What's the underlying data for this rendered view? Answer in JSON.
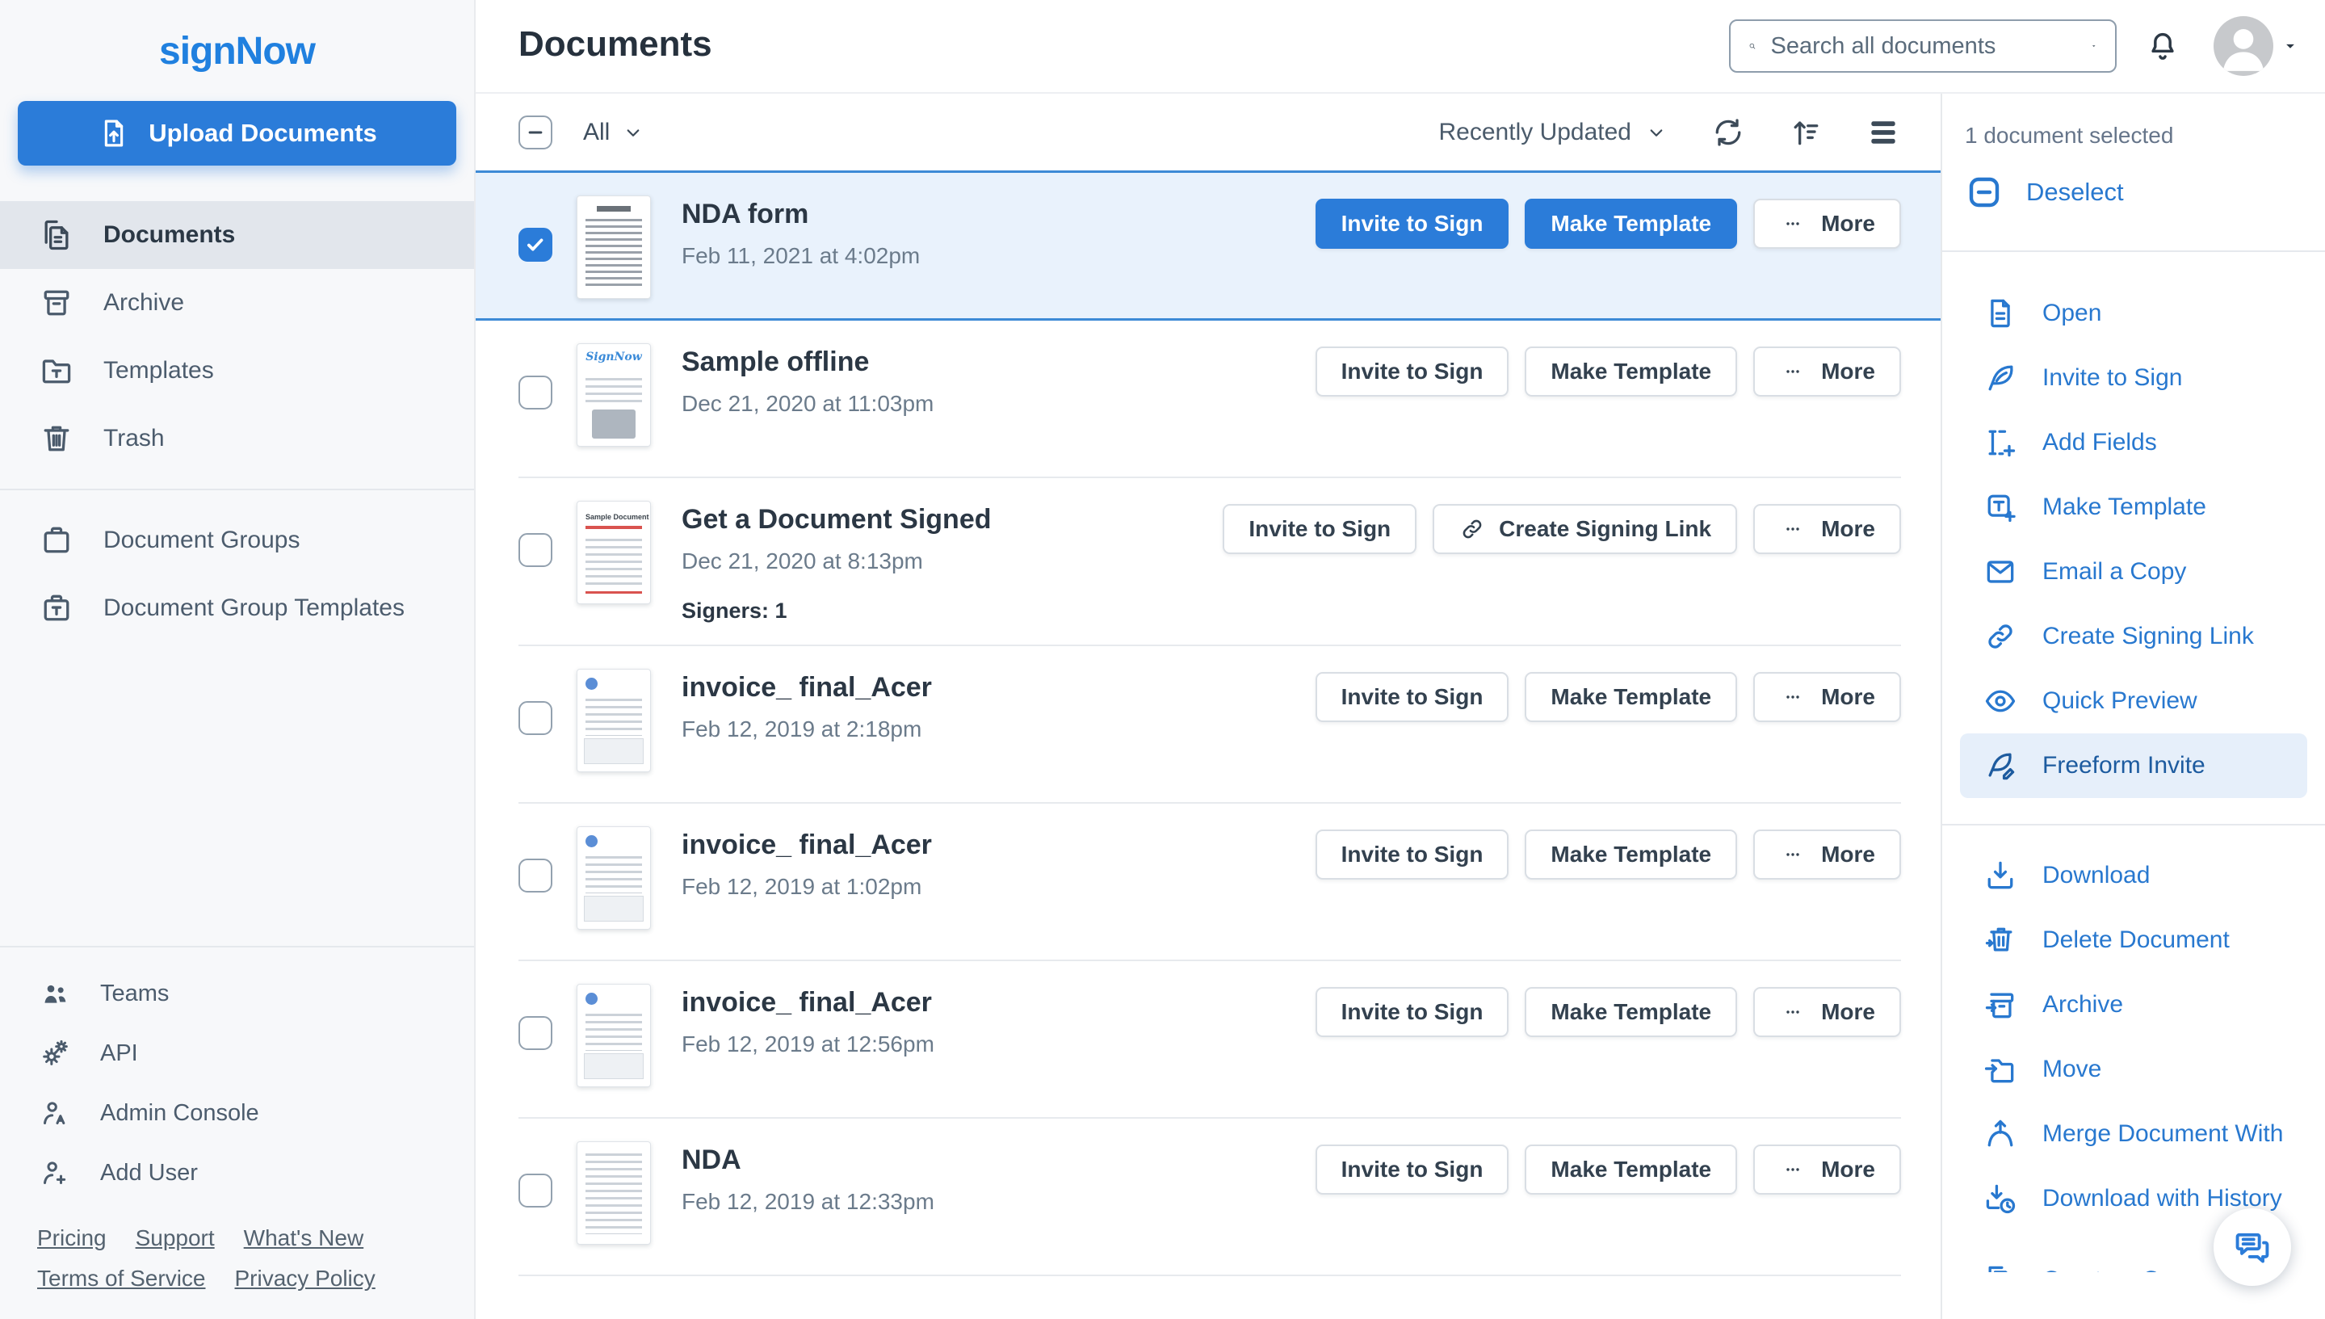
{
  "colors": {
    "primary_blue": "#2b7cd9",
    "logo_blue": "#2080df",
    "link_blue": "#2878cf",
    "active_item_blue": "#1d5b9f",
    "active_item_bg": "#e6effa",
    "selected_row_bg": "#e9f2fc",
    "selected_row_border": "#3d8ad6",
    "sidebar_bg": "#f7f8fa"
  },
  "sidebar": {
    "logo": "signNow",
    "upload_button": "Upload Documents",
    "nav": [
      {
        "key": "documents",
        "label": "Documents",
        "icon": "documents",
        "selected": true
      },
      {
        "key": "archive",
        "label": "Archive",
        "icon": "archive",
        "selected": false
      },
      {
        "key": "templates",
        "label": "Templates",
        "icon": "templates",
        "selected": false
      },
      {
        "key": "trash",
        "label": "Trash",
        "icon": "trash",
        "selected": false
      }
    ],
    "nav_secondary": [
      {
        "key": "document-groups",
        "label": "Document Groups",
        "icon": "doc-group"
      },
      {
        "key": "document-group-templates",
        "label": "Document Group Templates",
        "icon": "doc-group-template"
      }
    ],
    "nav_tertiary": [
      {
        "key": "teams",
        "label": "Teams",
        "icon": "teams"
      },
      {
        "key": "api",
        "label": "API",
        "icon": "api"
      },
      {
        "key": "admin-console",
        "label": "Admin Console",
        "icon": "admin"
      },
      {
        "key": "add-user",
        "label": "Add User",
        "icon": "add-user"
      }
    ],
    "footer_links": [
      "Pricing",
      "Support",
      "What's New",
      "Terms of Service",
      "Privacy Policy"
    ]
  },
  "header": {
    "title": "Documents",
    "search_placeholder": "Search all documents"
  },
  "toolbar": {
    "filter": "All",
    "sort": "Recently Updated"
  },
  "documents": [
    {
      "title": "NDA form",
      "date": "Feb 11, 2021 at 4:02pm",
      "selected": true,
      "thumb": "nda-form",
      "buttons": [
        {
          "label": "Invite to Sign",
          "style": "primary"
        },
        {
          "label": "Make Template",
          "style": "primary"
        },
        {
          "label": "More",
          "style": "more"
        }
      ]
    },
    {
      "title": "Sample offline",
      "date": "Dec 21, 2020 at 11:03pm",
      "selected": false,
      "thumb": "sample-offline",
      "buttons": [
        {
          "label": "Invite to Sign"
        },
        {
          "label": "Make Template"
        },
        {
          "label": "More",
          "style": "more"
        }
      ]
    },
    {
      "title": "Get a Document Signed",
      "date": "Dec 21, 2020 at 8:13pm",
      "signers": "Signers: 1",
      "selected": false,
      "thumb": "sample-doc",
      "buttons": [
        {
          "label": "Invite to Sign"
        },
        {
          "label": "Create Signing Link",
          "icon": "link"
        },
        {
          "label": "More",
          "style": "more"
        }
      ]
    },
    {
      "title": "invoice_ final_Acer",
      "date": "Feb 12, 2019 at 2:18pm",
      "selected": false,
      "thumb": "invoice",
      "buttons": [
        {
          "label": "Invite to Sign"
        },
        {
          "label": "Make Template"
        },
        {
          "label": "More",
          "style": "more"
        }
      ]
    },
    {
      "title": "invoice_ final_Acer",
      "date": "Feb 12, 2019 at 1:02pm",
      "selected": false,
      "thumb": "invoice",
      "buttons": [
        {
          "label": "Invite to Sign"
        },
        {
          "label": "Make Template"
        },
        {
          "label": "More",
          "style": "more"
        }
      ]
    },
    {
      "title": "invoice_ final_Acer",
      "date": "Feb 12, 2019 at 12:56pm",
      "selected": false,
      "thumb": "invoice",
      "buttons": [
        {
          "label": "Invite to Sign"
        },
        {
          "label": "Make Template"
        },
        {
          "label": "More",
          "style": "more"
        }
      ]
    },
    {
      "title": "NDA",
      "date": "Feb 12, 2019 at 12:33pm",
      "selected": false,
      "thumb": "nda",
      "buttons": [
        {
          "label": "Invite to Sign"
        },
        {
          "label": "Make Template"
        },
        {
          "label": "More",
          "style": "more"
        }
      ]
    }
  ],
  "panel": {
    "selected_count": "1 document selected",
    "deselect": "Deselect",
    "actions": [
      {
        "label": "Open",
        "icon": "open"
      },
      {
        "label": "Invite to Sign",
        "icon": "quill"
      },
      {
        "label": "Add Fields",
        "icon": "add-fields"
      },
      {
        "label": "Make Template",
        "icon": "make-template"
      },
      {
        "label": "Email a Copy",
        "icon": "mail"
      },
      {
        "label": "Create Signing Link",
        "icon": "link"
      },
      {
        "label": "Quick Preview",
        "icon": "eye"
      },
      {
        "label": "Freeform Invite",
        "icon": "freeform",
        "active": true
      }
    ],
    "actions_secondary": [
      {
        "label": "Download",
        "icon": "download"
      },
      {
        "label": "Delete Document",
        "icon": "delete"
      },
      {
        "label": "Archive",
        "icon": "archive-action"
      },
      {
        "label": "Move",
        "icon": "move"
      },
      {
        "label": "Merge Document With",
        "icon": "merge"
      },
      {
        "label": "Download with History",
        "icon": "download-history"
      },
      {
        "label": "Create a Copy",
        "icon": "copy",
        "cut": true
      }
    ]
  }
}
